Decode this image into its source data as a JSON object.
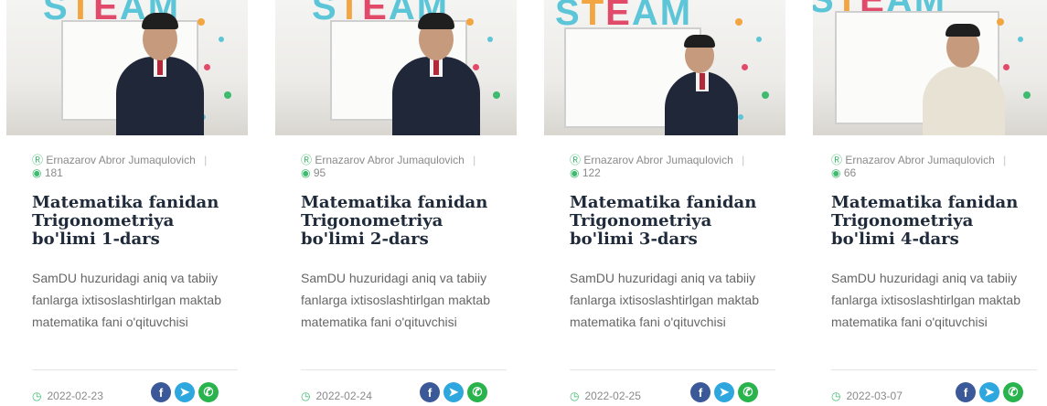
{
  "author_label": "Ernazarov Abror Jumaqulovich",
  "description": "SamDU huzuridagi aniq va tabiiy fanlarga ixtisoslashtirlgan maktab matematika fani o'qituvchisi",
  "icons": {
    "author": "user-circle-icon",
    "views": "eye-icon",
    "date": "clock-icon",
    "social": [
      "facebook-icon",
      "telegram-icon",
      "whatsapp-icon"
    ]
  },
  "thumb_text": "STEAM",
  "colors": {
    "accent_green": "#3dbb6e",
    "title": "#1f2a3a",
    "facebook": "#3b5998",
    "telegram": "#2ea6de",
    "whatsapp": "#29b34d"
  },
  "cards": [
    {
      "views": "181",
      "title": "Matematika fanidan Trigonometriya bo'limi 1-dars",
      "date": "2022-02-23"
    },
    {
      "views": "95",
      "title": "Matematika fanidan Trigonometriya bo'limi 2-dars",
      "date": "2022-02-24"
    },
    {
      "views": "122",
      "title": "Matematika fanidan Trigonometriya bo'limi 3-dars",
      "date": "2022-02-25"
    },
    {
      "views": "66",
      "title": "Matematika fanidan Trigonometriya bo'limi 4-dars",
      "date": "2022-03-07"
    }
  ]
}
